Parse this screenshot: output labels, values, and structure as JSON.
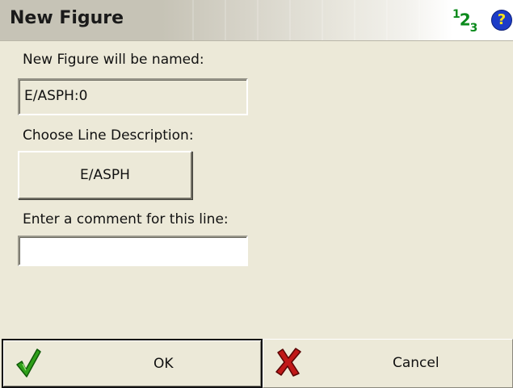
{
  "title": "New Figure",
  "header_icons": {
    "numeric_keypad_icon": {
      "prefix": "1",
      "main": "2",
      "suffix": "3"
    },
    "help_icon": "?"
  },
  "form": {
    "name_label": "New Figure will be named:",
    "name_value": "E/ASPH:0",
    "line_desc_label": "Choose Line Description:",
    "line_desc_button": "E/ASPH",
    "comment_label": "Enter a comment for this line:",
    "comment_value": ""
  },
  "actions": {
    "ok_label": "OK",
    "cancel_label": "Cancel"
  },
  "colors": {
    "ok_check": "#2fa01a",
    "cancel_x": "#c01818",
    "keypad_icon": "#0b8a1c",
    "help_icon_bg": "#1c3cc7",
    "help_icon_fg": "#f8e21a"
  }
}
